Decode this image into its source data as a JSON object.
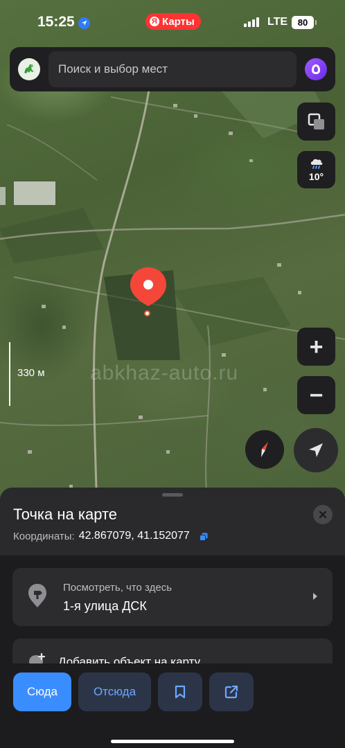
{
  "status_bar": {
    "time": "15:25",
    "app_badge": "Карты",
    "network": "LTE",
    "battery": "80"
  },
  "search": {
    "placeholder": "Поиск и выбор мест"
  },
  "map": {
    "weather_temp": "10°",
    "weather_icon": "cloud-rain-icon",
    "scale_label": "330 м",
    "watermark": "abkhaz-auto.ru",
    "imagery": "satellite"
  },
  "sheet": {
    "title": "Точка на карте",
    "coords_label": "Координаты:",
    "coords_value": "42.867079, 41.152077",
    "whats_here_label": "Посмотреть, что здесь",
    "whats_here_value": "1-я улица ДСК",
    "add_object_label": "Добавить объект на карту"
  },
  "actions": {
    "here": "Сюда",
    "from": "Отсюда"
  },
  "colors": {
    "accent": "#3a8dff",
    "pin": "#f4473a",
    "sheet_bg": "#1c1c1e",
    "card_bg": "#2c2c2e"
  }
}
